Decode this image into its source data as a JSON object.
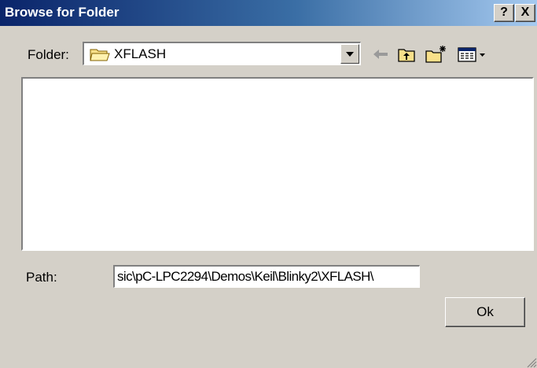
{
  "window": {
    "title": "Browse for Folder",
    "help_label": "?",
    "close_label": "X"
  },
  "folder": {
    "label": "Folder:",
    "selected": "XFLASH"
  },
  "toolbar": {
    "icons": [
      "back-arrow-icon",
      "up-folder-icon",
      "new-folder-icon",
      "view-menu-icon"
    ]
  },
  "path": {
    "label": "Path:",
    "value": "sic\\pC-LPC2294\\Demos\\Keil\\Blinky2\\XFLASH\\"
  },
  "buttons": {
    "ok": "Ok"
  },
  "colors": {
    "titlebar_start": "#0a246a",
    "titlebar_end": "#a6caf0",
    "face": "#d4d0c8"
  }
}
